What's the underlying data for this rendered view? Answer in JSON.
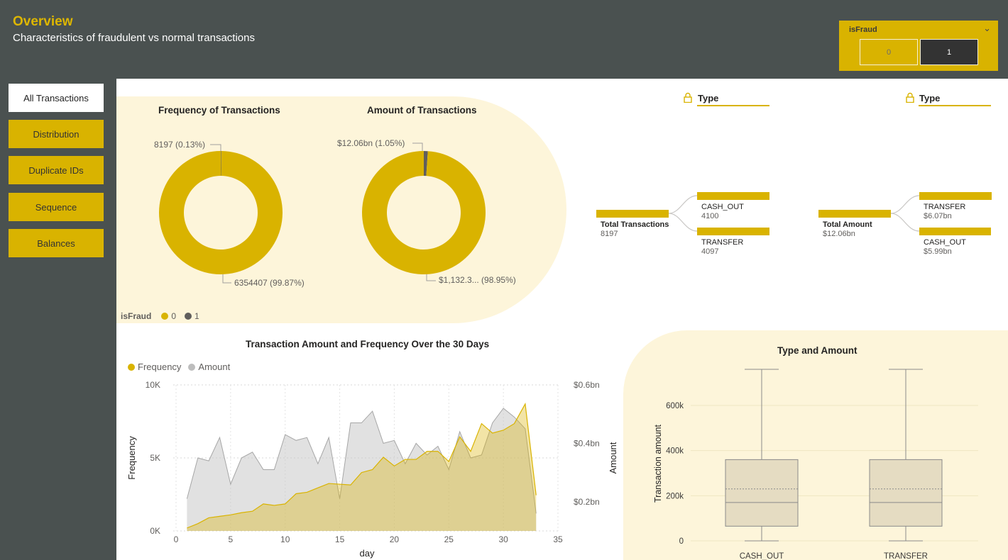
{
  "header": {
    "title": "Overview",
    "subtitle": "Characteristics of fraudulent vs normal transactions"
  },
  "slicer": {
    "title": "isFraud",
    "options": [
      "0",
      "1"
    ],
    "selected": "1"
  },
  "nav": {
    "items": [
      {
        "label": "All Transactions",
        "active": true
      },
      {
        "label": "Distribution",
        "active": false
      },
      {
        "label": "Duplicate IDs",
        "active": false
      },
      {
        "label": "Sequence",
        "active": false
      },
      {
        "label": "Balances",
        "active": false
      }
    ]
  },
  "colors": {
    "gold": "#d9b300",
    "dark": "#4a5150",
    "grey_area": "#bdbdbd",
    "panel": "#fdf5da"
  },
  "donuts": {
    "legend_title": "isFraud",
    "legend_items": [
      "0",
      "1"
    ],
    "frequency": {
      "title": "Frequency of Transactions",
      "label_small": "8197 (0.13%)",
      "label_large": "6354407 (99.87%)"
    },
    "amount": {
      "title": "Amount of Transactions",
      "label_small": "$12.06bn (1.05%)",
      "label_large": "$1,132.3... (98.95%)"
    }
  },
  "decomp_trees": [
    {
      "header": "Type",
      "root_name": "Total Transactions",
      "root_value": "8197",
      "children": [
        {
          "name": "CASH_OUT",
          "value": "4100"
        },
        {
          "name": "TRANSFER",
          "value": "4097"
        }
      ]
    },
    {
      "header": "Type",
      "root_name": "Total Amount",
      "root_value": "$12.06bn",
      "children": [
        {
          "name": "TRANSFER",
          "value": "$6.07bn"
        },
        {
          "name": "CASH_OUT",
          "value": "$5.99bn"
        }
      ]
    }
  ],
  "line_chart": {
    "title": "Transaction Amount and Frequency Over the 30 Days",
    "legend": [
      "Frequency",
      "Amount"
    ],
    "y_left_label": "Frequency",
    "y_right_label": "Amount",
    "x_label": "day",
    "y_left_ticks": [
      "10K",
      "5K",
      "0K"
    ],
    "y_right_ticks": [
      "$0.6bn",
      "$0.4bn",
      "$0.2bn"
    ],
    "x_ticks": [
      "0",
      "5",
      "10",
      "15",
      "20",
      "25",
      "30",
      "35"
    ]
  },
  "box_chart": {
    "title": "Type and Amount",
    "ylabel": "Transaction amount",
    "y_ticks": [
      "600k",
      "400k",
      "200k",
      "0"
    ],
    "categories": [
      "CASH_OUT",
      "TRANSFER"
    ]
  },
  "chart_data": [
    {
      "type": "pie",
      "title": "Frequency of Transactions",
      "categories": [
        "0",
        "1"
      ],
      "values": [
        6354407,
        8197
      ]
    },
    {
      "type": "pie",
      "title": "Amount of Transactions",
      "categories": [
        "0",
        "1"
      ],
      "values": [
        1132.3,
        12.06
      ],
      "unit": "$bn"
    },
    {
      "type": "area",
      "title": "Transaction Amount and Frequency Over the 30 Days",
      "xlabel": "day",
      "x": [
        1,
        2,
        3,
        4,
        5,
        6,
        7,
        8,
        9,
        10,
        11,
        12,
        13,
        14,
        15,
        16,
        17,
        18,
        19,
        20,
        21,
        22,
        23,
        24,
        25,
        26,
        27,
        28,
        29,
        30,
        31,
        32,
        33
      ],
      "xlim": [
        0,
        35
      ],
      "series": [
        {
          "name": "Frequency",
          "axis": "left",
          "ylim": [
            0,
            10000
          ],
          "values": [
            200,
            500,
            900,
            1000,
            1100,
            1250,
            1350,
            1850,
            1750,
            1850,
            2550,
            2650,
            2950,
            3250,
            3200,
            3150,
            4000,
            4200,
            5050,
            4450,
            4900,
            4900,
            5450,
            5450,
            4750,
            6450,
            5450,
            7350,
            6700,
            6900,
            7350,
            8700,
            2450
          ]
        },
        {
          "name": "Amount",
          "axis": "right",
          "ylim": [
            0.1,
            0.6
          ],
          "unit": "$bn",
          "values": [
            0.21,
            0.35,
            0.34,
            0.42,
            0.26,
            0.35,
            0.37,
            0.31,
            0.31,
            0.43,
            0.41,
            0.42,
            0.33,
            0.42,
            0.21,
            0.47,
            0.47,
            0.51,
            0.4,
            0.41,
            0.33,
            0.4,
            0.36,
            0.39,
            0.31,
            0.44,
            0.35,
            0.36,
            0.47,
            0.52,
            0.49,
            0.45,
            0.16
          ]
        }
      ]
    },
    {
      "type": "box",
      "title": "Type and Amount",
      "ylabel": "Transaction amount",
      "ylim": [
        0,
        760000
      ],
      "categories": [
        "CASH_OUT",
        "TRANSFER"
      ],
      "boxes": [
        {
          "name": "CASH_OUT",
          "min": 0,
          "q1": 65000,
          "median": 170000,
          "mean": 230000,
          "q3": 360000,
          "max": 760000
        },
        {
          "name": "TRANSFER",
          "min": 0,
          "q1": 65000,
          "median": 170000,
          "mean": 230000,
          "q3": 360000,
          "max": 760000
        }
      ]
    }
  ]
}
